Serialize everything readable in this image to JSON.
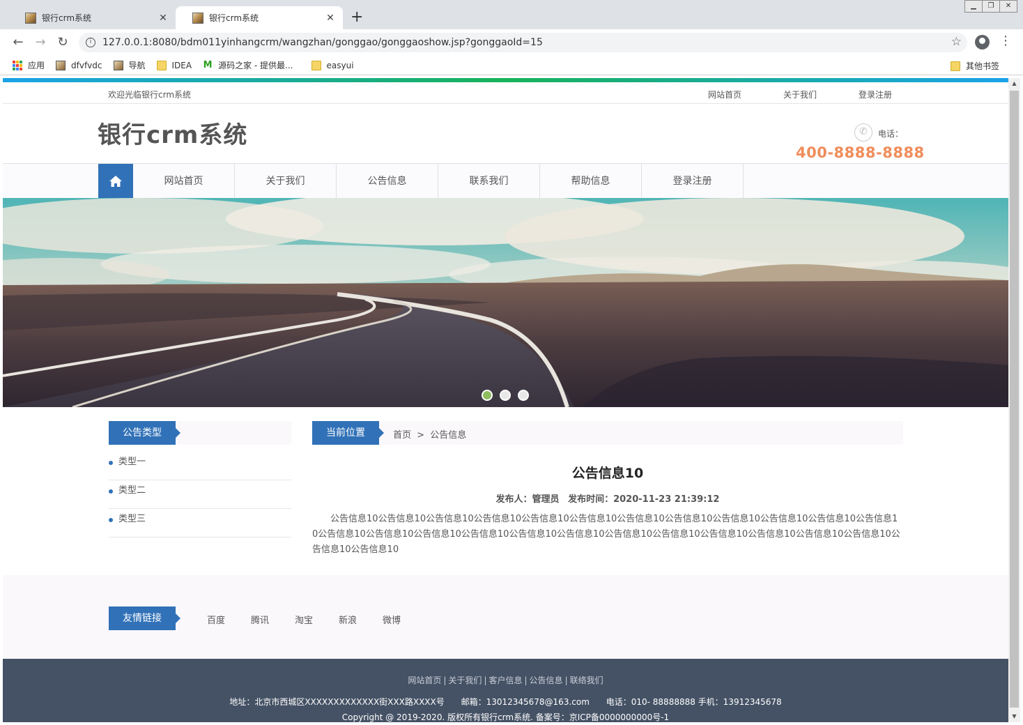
{
  "browser": {
    "tabs": [
      {
        "title": "银行crm系统",
        "active": false
      },
      {
        "title": "银行crm系统",
        "active": true
      }
    ],
    "url": "127.0.0.1:8080/bdm011yinhangcrm/wangzhan/gonggao/gonggaoshow.jsp?gonggaoId=15",
    "bookmarks": [
      "应用",
      "dfvfvdc",
      "导航",
      "IDEA",
      "源码之家 - 提供最...",
      "easyui"
    ],
    "other_bookmarks": "其他书签"
  },
  "topbar": {
    "welcome": "欢迎光临银行crm系统",
    "links": [
      "网站首页",
      "关于我们",
      "登录注册"
    ]
  },
  "header": {
    "site_title": "银行crm系统",
    "phone_label": "电话：",
    "phone_number": "400-8888-8888"
  },
  "nav": {
    "items": [
      "网站首页",
      "关于我们",
      "公告信息",
      "联系我们",
      "帮助信息",
      "登录注册"
    ]
  },
  "banner": {
    "slide_count": 3,
    "active_slide": 1
  },
  "sidebar": {
    "heading": "公告类型",
    "types": [
      "类型一",
      "类型二",
      "类型三"
    ]
  },
  "article": {
    "location_label": "当前位置",
    "crumb_home": "首页",
    "crumb_sep": ">",
    "crumb_current": "公告信息",
    "title": "公告信息10",
    "publisher": "发布人：管理员",
    "publish_time": "发布时间：2020-11-23 21:39:12",
    "body": "公告信息10公告信息10公告信息10公告信息10公告信息10公告信息10公告信息10公告信息10公告信息10公告信息10公告信息10公告信息10公告信息10公告信息10公告信息10公告信息10公告信息10公告信息10公告信息10公告信息10公告信息10公告信息10公告信息10公告信息10公告信息10公告信息10"
  },
  "friends": {
    "heading": "友情链接",
    "links": [
      "百度",
      "腾讯",
      "淘宝",
      "新浪",
      "微博"
    ]
  },
  "footer": {
    "links": [
      "网站首页",
      "关于我们",
      "客户信息",
      "公告信息",
      "联络我们"
    ],
    "address": "地址：北京市西城区XXXXXXXXXXXXX街XXX路XXXX号",
    "email": "邮箱：13012345678@163.com",
    "phone": "电话：010- 88888888 手机：13912345678",
    "copyright": "Copyright @ 2019-2020. 版权所有银行crm系统. 备案号：京ICP备0000000000号-1"
  },
  "colors": {
    "accent_blue": "#3171b7",
    "phone_orange": "#ef8d5b",
    "footer_bg": "#455265"
  }
}
